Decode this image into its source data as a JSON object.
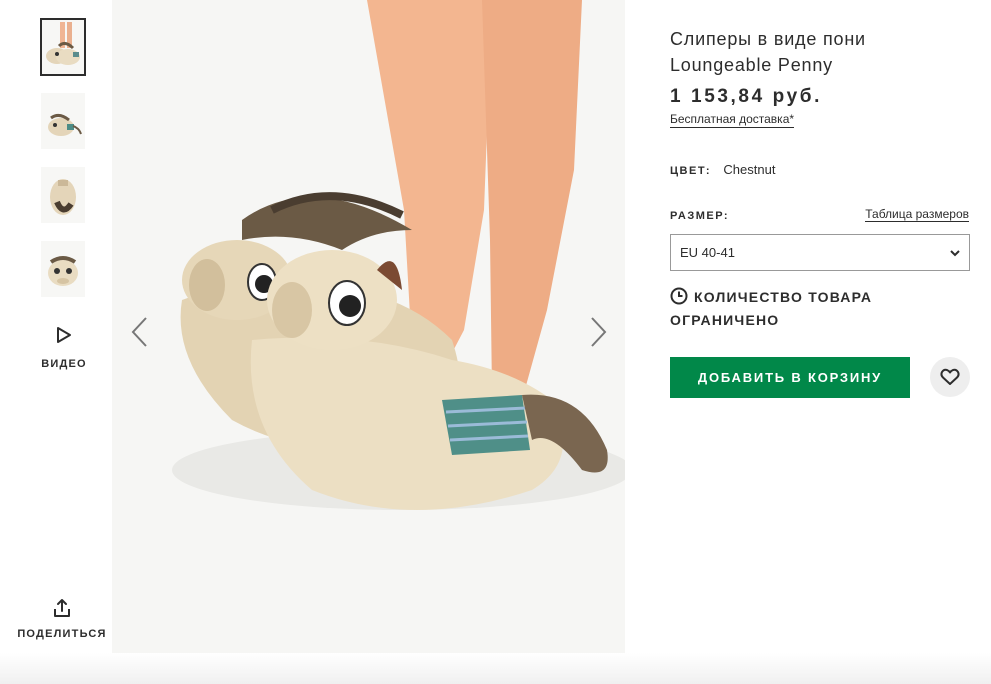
{
  "product": {
    "title": "Слиперы в виде пони Loungeable Penny",
    "price": "1 153,84 руб.",
    "delivery_link": "Бесплатная доставка*"
  },
  "color": {
    "label": "ЦВЕТ:",
    "value": "Chestnut"
  },
  "size": {
    "label": "РАЗМЕР:",
    "chart_link": "Таблица размеров",
    "selected": "EU 40-41"
  },
  "stock": {
    "message": "КОЛИЧЕСТВО ТОВАРА ОГРАНИЧЕНО"
  },
  "actions": {
    "add_to_bag": "ДОБАВИТЬ В КОРЗИНУ"
  },
  "gallery": {
    "video_label": "ВИДЕО",
    "share_label": "ПОДЕЛИТЬСЯ"
  },
  "colors": {
    "accent_green": "#018849",
    "text_dark": "#2d2d2d"
  }
}
